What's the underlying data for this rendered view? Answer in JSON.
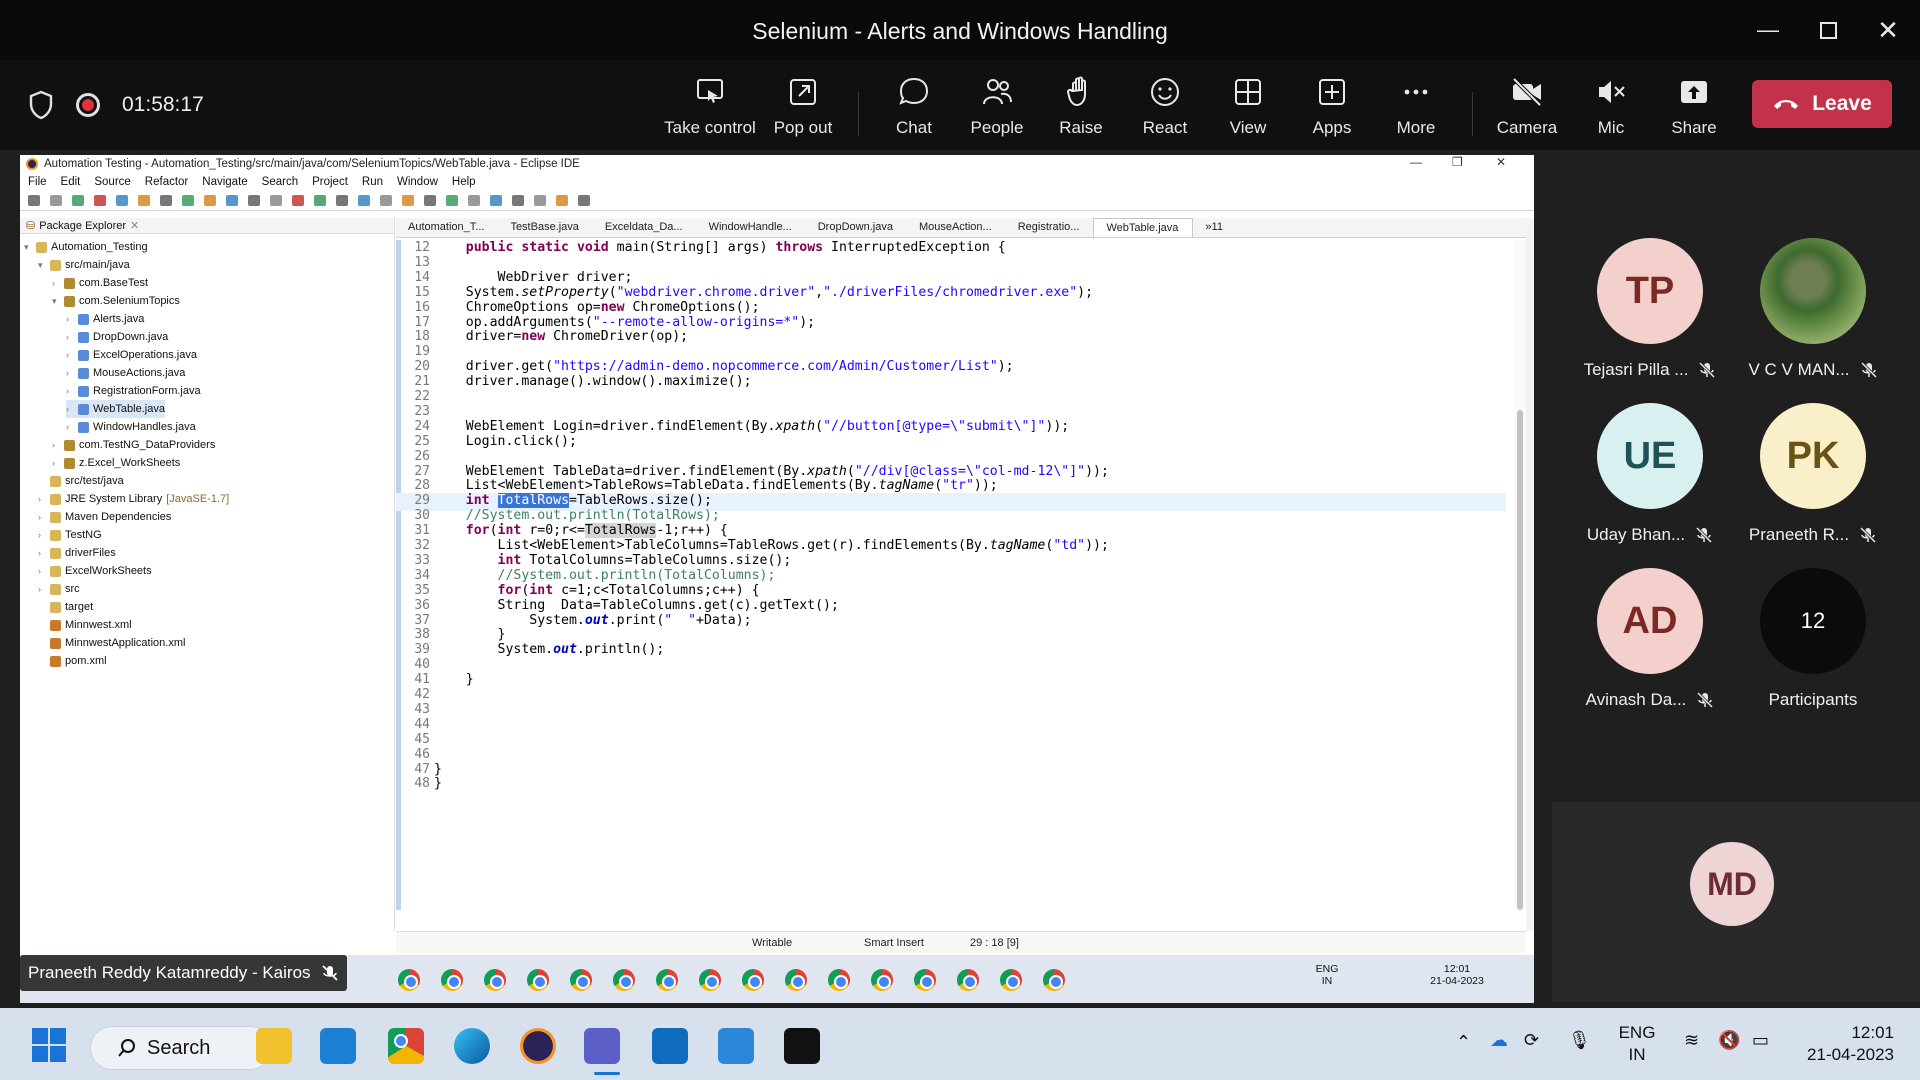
{
  "window": {
    "title": "Selenium - Alerts and Windows Handling"
  },
  "meeting": {
    "timer": "01:58:17",
    "toolbar": [
      {
        "key": "take_control",
        "label": "Take control"
      },
      {
        "key": "pop_out",
        "label": "Pop out"
      },
      {
        "key": "chat",
        "label": "Chat"
      },
      {
        "key": "people",
        "label": "People"
      },
      {
        "key": "raise",
        "label": "Raise"
      },
      {
        "key": "react",
        "label": "React"
      },
      {
        "key": "view",
        "label": "View"
      },
      {
        "key": "apps",
        "label": "Apps"
      },
      {
        "key": "more",
        "label": "More"
      },
      {
        "key": "camera",
        "label": "Camera"
      },
      {
        "key": "mic",
        "label": "Mic"
      },
      {
        "key": "share",
        "label": "Share"
      }
    ],
    "leave_label": "Leave",
    "presenter": "Praneeth Reddy Katamreddy - Kairos"
  },
  "eclipse": {
    "title": "Automation Testing - Automation_Testing/src/main/java/com/SeleniumTopics/WebTable.java - Eclipse IDE",
    "menu": [
      "File",
      "Edit",
      "Source",
      "Refactor",
      "Navigate",
      "Search",
      "Project",
      "Run",
      "Window",
      "Help"
    ],
    "package_explorer_title": "Package Explorer",
    "tree": [
      {
        "label": "Automation_Testing",
        "indent": 0,
        "arrow": "▾"
      },
      {
        "label": "src/main/java",
        "indent": 1,
        "arrow": "▾"
      },
      {
        "label": "com.BaseTest",
        "indent": 2,
        "arrow": "›"
      },
      {
        "label": "com.SeleniumTopics",
        "indent": 2,
        "arrow": "▾"
      },
      {
        "label": "Alerts.java",
        "indent": 3,
        "arrow": "›"
      },
      {
        "label": "DropDown.java",
        "indent": 3,
        "arrow": "›"
      },
      {
        "label": "ExcelOperations.java",
        "indent": 3,
        "arrow": "›"
      },
      {
        "label": "MouseActions.java",
        "indent": 3,
        "arrow": "›"
      },
      {
        "label": "RegistrationForm.java",
        "indent": 3,
        "arrow": "›"
      },
      {
        "label": "WebTable.java",
        "indent": 3,
        "arrow": "›",
        "selected": true
      },
      {
        "label": "WindowHandles.java",
        "indent": 3,
        "arrow": "›"
      },
      {
        "label": "com.TestNG_DataProviders",
        "indent": 2,
        "arrow": "›"
      },
      {
        "label": "z.Excel_WorkSheets",
        "indent": 2,
        "arrow": "›"
      },
      {
        "label": "src/test/java",
        "indent": 1,
        "arrow": ""
      },
      {
        "label": "JRE System Library",
        "suffix": "[JavaSE-1.7]",
        "indent": 1,
        "arrow": "›"
      },
      {
        "label": "Maven Dependencies",
        "indent": 1,
        "arrow": "›"
      },
      {
        "label": "TestNG",
        "indent": 1,
        "arrow": "›"
      },
      {
        "label": "driverFiles",
        "indent": 1,
        "arrow": "›"
      },
      {
        "label": "ExcelWorkSheets",
        "indent": 1,
        "arrow": "›"
      },
      {
        "label": "src",
        "indent": 1,
        "arrow": "›"
      },
      {
        "label": "target",
        "indent": 1,
        "arrow": ""
      },
      {
        "label": "Minnwest.xml",
        "indent": 1,
        "arrow": ""
      },
      {
        "label": "MinnwestApplication.xml",
        "indent": 1,
        "arrow": ""
      },
      {
        "label": "pom.xml",
        "indent": 1,
        "arrow": ""
      }
    ],
    "tabs": [
      "Automation_T...",
      "TestBase.java",
      "Exceldata_Da...",
      "WindowHandle...",
      "DropDown.java",
      "MouseAction...",
      "Registratio...",
      "WebTable.java",
      "»11"
    ],
    "active_tab": "WebTable.java",
    "code": [
      {
        "n": "12",
        "t": "    public static void main(String[] args) throws InterruptedException {"
      },
      {
        "n": "13",
        "t": ""
      },
      {
        "n": "14",
        "t": "        WebDriver driver;"
      },
      {
        "n": "15",
        "t": "    System.setProperty(\"webdriver.chrome.driver\",\"./driverFiles/chromedriver.exe\");"
      },
      {
        "n": "16",
        "t": "    ChromeOptions op=new ChromeOptions();"
      },
      {
        "n": "17",
        "t": "    op.addArguments(\"--remote-allow-origins=*\");"
      },
      {
        "n": "18",
        "t": "    driver=new ChromeDriver(op);"
      },
      {
        "n": "19",
        "t": ""
      },
      {
        "n": "20",
        "t": "    driver.get(\"https://admin-demo.nopcommerce.com/Admin/Customer/List\");"
      },
      {
        "n": "21",
        "t": "    driver.manage().window().maximize();"
      },
      {
        "n": "22",
        "t": ""
      },
      {
        "n": "23",
        "t": ""
      },
      {
        "n": "24",
        "t": "    WebElement Login=driver.findElement(By.xpath(\"//button[@type=\\\"submit\\\"]\"));"
      },
      {
        "n": "25",
        "t": "    Login.click();"
      },
      {
        "n": "26",
        "t": ""
      },
      {
        "n": "27",
        "t": "    WebElement TableData=driver.findElement(By.xpath(\"//div[@class=\\\"col-md-12\\\"]\"));"
      },
      {
        "n": "28",
        "t": "    List<WebElement>TableRows=TableData.findElements(By.tagName(\"tr\"));"
      },
      {
        "n": "29",
        "t": "    int TotalRows=TableRows.size();"
      },
      {
        "n": "30",
        "t": "    //System.out.println(TotalRows);"
      },
      {
        "n": "31",
        "t": "    for(int r=0;r<=TotalRows-1;r++) {"
      },
      {
        "n": "32",
        "t": "        List<WebElement>TableColumns=TableRows.get(r).findElements(By.tagName(\"td\"));"
      },
      {
        "n": "33",
        "t": "        int TotalColumns=TableColumns.size();"
      },
      {
        "n": "34",
        "t": "        //System.out.println(TotalColumns);"
      },
      {
        "n": "35",
        "t": "        for(int c=1;c<TotalColumns;c++) {"
      },
      {
        "n": "36",
        "t": "        String  Data=TableColumns.get(c).getText();"
      },
      {
        "n": "37",
        "t": "            System.out.print(\"  \"+Data);"
      },
      {
        "n": "38",
        "t": "        }"
      },
      {
        "n": "39",
        "t": "        System.out.println();"
      },
      {
        "n": "40",
        "t": ""
      },
      {
        "n": "41",
        "t": "    }"
      },
      {
        "n": "42",
        "t": ""
      },
      {
        "n": "43",
        "t": ""
      },
      {
        "n": "44",
        "t": ""
      },
      {
        "n": "45",
        "t": ""
      },
      {
        "n": "46",
        "t": ""
      },
      {
        "n": "47",
        "t": "}"
      },
      {
        "n": "48",
        "t": "}"
      }
    ],
    "status": {
      "writable": "Writable",
      "insert": "Smart Insert",
      "position": "29 : 18 [9]"
    },
    "inner_tray": {
      "lang1": "ENG",
      "lang2": "IN",
      "time": "12:01",
      "date": "21-04-2023"
    }
  },
  "participants": [
    {
      "initials": "TP",
      "name": "Tejasri Pilla ...",
      "bg": "#f3d0cc",
      "fg": "#7a2a24",
      "muted": true
    },
    {
      "initials": "",
      "name": "V C V MAN...",
      "photo": true,
      "muted": true
    },
    {
      "initials": "UE",
      "name": "Uday Bhan...",
      "bg": "#d9f0f0",
      "fg": "#1f5357",
      "muted": true
    },
    {
      "initials": "PK",
      "name": "Praneeth R...",
      "bg": "#f9efc8",
      "fg": "#6a5316",
      "muted": true
    },
    {
      "initials": "AD",
      "name": "Avinash Da...",
      "bg": "#f3d0cc",
      "fg": "#7a2a24",
      "muted": true
    },
    {
      "initials": "12",
      "name": "Participants",
      "bg": "#0b0b0b",
      "fg": "#ffffff",
      "muted": false
    }
  ],
  "self_view": {
    "initials": "MD"
  },
  "taskbar": {
    "search_label": "Search",
    "lang1": "ENG",
    "lang2": "IN",
    "time": "12:01",
    "date": "21-04-2023"
  }
}
